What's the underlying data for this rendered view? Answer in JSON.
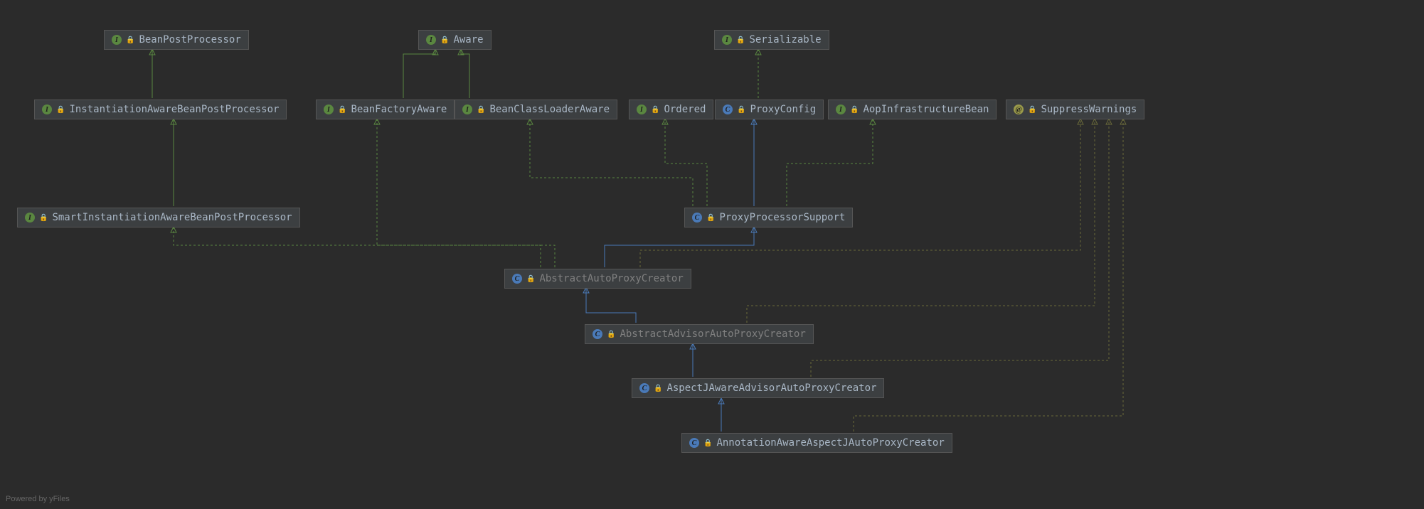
{
  "watermark": "Powered by yFiles",
  "nodes": {
    "beanPostProcessor": {
      "label": "BeanPostProcessor",
      "type": "interface"
    },
    "aware": {
      "label": "Aware",
      "type": "interface"
    },
    "serializable": {
      "label": "Serializable",
      "type": "interface"
    },
    "instantiationAware": {
      "label": "InstantiationAwareBeanPostProcessor",
      "type": "interface"
    },
    "beanFactoryAware": {
      "label": "BeanFactoryAware",
      "type": "interface"
    },
    "beanClassLoaderAware": {
      "label": "BeanClassLoaderAware",
      "type": "interface"
    },
    "ordered": {
      "label": "Ordered",
      "type": "interface"
    },
    "proxyConfig": {
      "label": "ProxyConfig",
      "type": "class"
    },
    "aopInfraBean": {
      "label": "AopInfrastructureBean",
      "type": "interface"
    },
    "suppressWarnings": {
      "label": "SuppressWarnings",
      "type": "annotation"
    },
    "smartInstantiation": {
      "label": "SmartInstantiationAwareBeanPostProcessor",
      "type": "interface"
    },
    "proxyProcessorSupport": {
      "label": "ProxyProcessorSupport",
      "type": "class"
    },
    "abstractAutoProxy": {
      "label": "AbstractAutoProxyCreator",
      "type": "abstract-class"
    },
    "abstractAdvisor": {
      "label": "AbstractAdvisorAutoProxyCreator",
      "type": "abstract-class"
    },
    "aspectJAware": {
      "label": "AspectJAwareAdvisorAutoProxyCreator",
      "type": "class"
    },
    "annotationAware": {
      "label": "AnnotationAwareAspectJAutoProxyCreator",
      "type": "class"
    }
  },
  "chart_data": {
    "type": "diagram",
    "description": "Java class hierarchy UML diagram",
    "edges": [
      {
        "from": "instantiationAware",
        "to": "beanPostProcessor",
        "relation": "extends-interface"
      },
      {
        "from": "beanFactoryAware",
        "to": "aware",
        "relation": "extends-interface"
      },
      {
        "from": "beanClassLoaderAware",
        "to": "aware",
        "relation": "extends-interface"
      },
      {
        "from": "proxyConfig",
        "to": "serializable",
        "relation": "implements"
      },
      {
        "from": "smartInstantiation",
        "to": "instantiationAware",
        "relation": "extends-interface"
      },
      {
        "from": "proxyProcessorSupport",
        "to": "ordered",
        "relation": "implements"
      },
      {
        "from": "proxyProcessorSupport",
        "to": "beanClassLoaderAware",
        "relation": "implements"
      },
      {
        "from": "proxyProcessorSupport",
        "to": "aopInfraBean",
        "relation": "implements"
      },
      {
        "from": "proxyProcessorSupport",
        "to": "proxyConfig",
        "relation": "extends-class"
      },
      {
        "from": "abstractAutoProxy",
        "to": "smartInstantiation",
        "relation": "implements"
      },
      {
        "from": "abstractAutoProxy",
        "to": "beanFactoryAware",
        "relation": "implements"
      },
      {
        "from": "abstractAutoProxy",
        "to": "proxyProcessorSupport",
        "relation": "extends-class"
      },
      {
        "from": "abstractAutoProxy",
        "to": "suppressWarnings",
        "relation": "annotation"
      },
      {
        "from": "abstractAdvisor",
        "to": "abstractAutoProxy",
        "relation": "extends-class"
      },
      {
        "from": "abstractAdvisor",
        "to": "suppressWarnings",
        "relation": "annotation"
      },
      {
        "from": "aspectJAware",
        "to": "abstractAdvisor",
        "relation": "extends-class"
      },
      {
        "from": "aspectJAware",
        "to": "suppressWarnings",
        "relation": "annotation"
      },
      {
        "from": "annotationAware",
        "to": "aspectJAware",
        "relation": "extends-class"
      },
      {
        "from": "annotationAware",
        "to": "suppressWarnings",
        "relation": "annotation"
      }
    ]
  }
}
